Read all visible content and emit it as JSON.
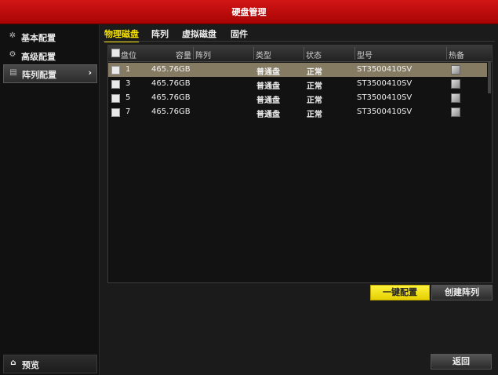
{
  "window": {
    "title": "硬盘管理"
  },
  "sidebar": {
    "items": [
      {
        "label": "基本配置",
        "icon": "gear-icon"
      },
      {
        "label": "高级配置",
        "icon": "advanced-settings-icon"
      },
      {
        "label": "阵列配置",
        "icon": "array-icon",
        "active": true
      }
    ],
    "preview": {
      "label": "预览",
      "icon": "home-icon"
    }
  },
  "tabs": [
    {
      "label": "物理磁盘",
      "active": true
    },
    {
      "label": "阵列"
    },
    {
      "label": "虚拟磁盘"
    },
    {
      "label": "固件"
    }
  ],
  "table": {
    "headers": {
      "slot": "盘位",
      "capacity": "容量",
      "array": "阵列",
      "type": "类型",
      "status": "状态",
      "model": "型号",
      "hotspare": "热备"
    },
    "rows": [
      {
        "slot": "1",
        "capacity": "465.76GB",
        "array": "",
        "type": "普通盘",
        "status": "正常",
        "model": "ST3500410SV",
        "selected": true
      },
      {
        "slot": "3",
        "capacity": "465.76GB",
        "array": "",
        "type": "普通盘",
        "status": "正常",
        "model": "ST3500410SV"
      },
      {
        "slot": "5",
        "capacity": "465.76GB",
        "array": "",
        "type": "普通盘",
        "status": "正常",
        "model": "ST3500410SV"
      },
      {
        "slot": "7",
        "capacity": "465.76GB",
        "array": "",
        "type": "普通盘",
        "status": "正常",
        "model": "ST3500410SV"
      }
    ]
  },
  "buttons": {
    "one_key_config": "一键配置",
    "create_array": "创建阵列",
    "back": "返回"
  },
  "colors": {
    "title_bar": "#c40c0c",
    "accent_yellow": "#f4e100",
    "selected_row": "#857b63"
  }
}
